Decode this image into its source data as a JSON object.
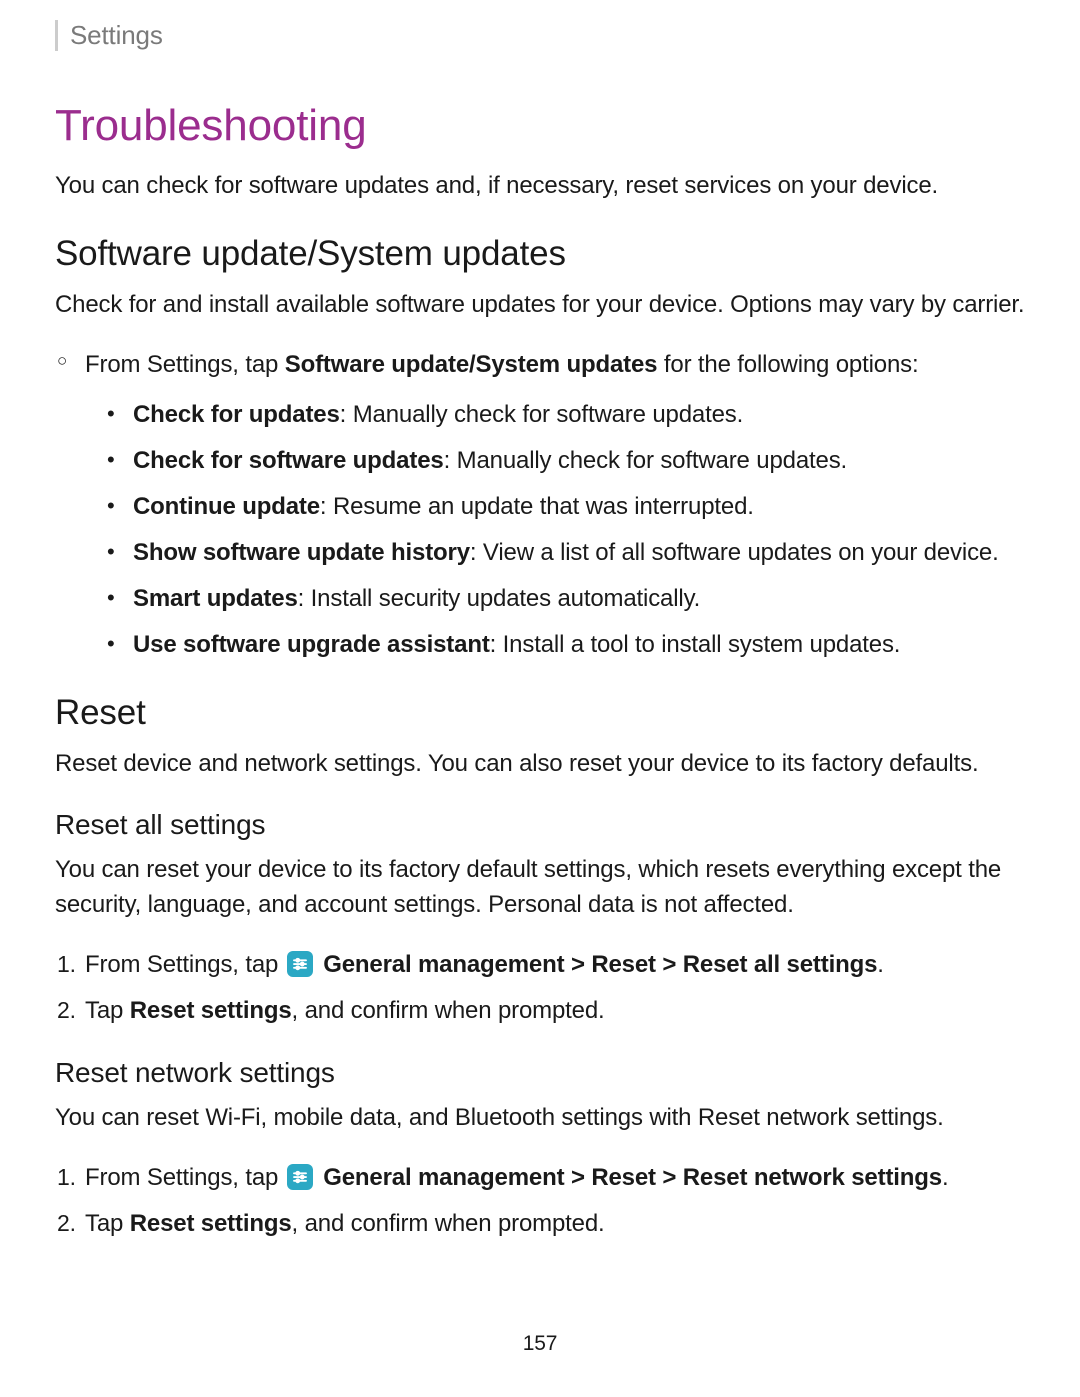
{
  "breadcrumb": "Settings",
  "h1": "Troubleshooting",
  "intro": "You can check for software updates and, if necessary, reset services on your device.",
  "section1": {
    "heading": "Software update/System updates",
    "desc": "Check for and install available software updates for your device. Options may vary by carrier.",
    "lead_pre": "From Settings, tap ",
    "lead_bold": "Software update/System updates",
    "lead_post": " for the following options:",
    "items": [
      {
        "b": "Check for updates",
        "t": ": Manually check for software updates."
      },
      {
        "b": "Check for software updates",
        "t": ": Manually check for software updates."
      },
      {
        "b": "Continue update",
        "t": ": Resume an update that was interrupted."
      },
      {
        "b": "Show software update history",
        "t": ": View a list of all software updates on your device."
      },
      {
        "b": "Smart updates",
        "t": ": Install security updates automatically."
      },
      {
        "b": "Use software upgrade assistant",
        "t": ": Install a tool to install system updates."
      }
    ]
  },
  "section2": {
    "heading": "Reset",
    "desc": "Reset device and network settings. You can also reset your device to its factory defaults."
  },
  "sub1": {
    "heading": "Reset all settings",
    "desc": "You can reset your device to its factory default settings, which resets everything except the security, language, and account settings. Personal data is not affected.",
    "step1_pre": "From Settings, tap ",
    "step1_path": "General management > Reset > Reset all settings",
    "step1_post": ".",
    "step2_pre": "Tap ",
    "step2_bold": "Reset settings",
    "step2_post": ", and confirm when prompted."
  },
  "sub2": {
    "heading": "Reset network settings",
    "desc": "You can reset Wi-Fi, mobile data, and Bluetooth settings with Reset network settings.",
    "step1_pre": "From Settings, tap ",
    "step1_path": "General management > Reset > Reset network settings",
    "step1_post": ".",
    "step2_pre": "Tap ",
    "step2_bold": "Reset settings",
    "step2_post": ", and confirm when prompted."
  },
  "page_number": "157"
}
